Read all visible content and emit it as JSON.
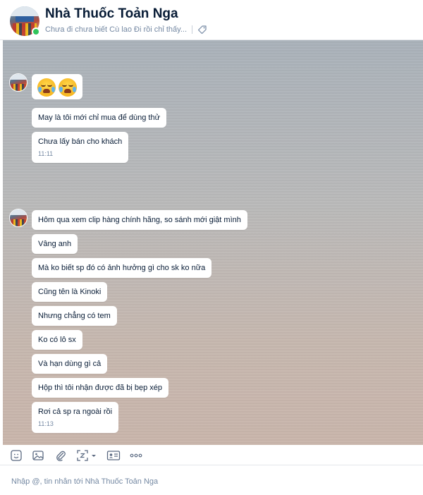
{
  "header": {
    "title": "Nhà Thuốc Toản Nga",
    "subtitle": "Chưa đi chưa biết Cù lao Đi rồi chỉ thấy...",
    "online_color": "#31c45b"
  },
  "chat": {
    "group1": {
      "emoji": [
        "crying-face",
        "crying-face"
      ],
      "messages": [
        {
          "text": "May là tôi mới chỉ mua để dùng thử"
        },
        {
          "text": "Chưa lấy bán cho khách",
          "time": "11:11"
        }
      ]
    },
    "group2": {
      "messages": [
        {
          "text": "Hôm qua xem clip hàng chính hãng, so sánh mới giật mình"
        },
        {
          "text": "Vâng anh"
        },
        {
          "text": "Mà ko biết sp đó có ảnh hưởng gì cho sk ko nữa"
        },
        {
          "text": "Cũng tên là Kinoki"
        },
        {
          "text": "Nhưng chẳng có tem"
        },
        {
          "text": "Ko có lô sx"
        },
        {
          "text": "Và hạn dùng gì cả"
        },
        {
          "text": "Hộp thì tôi nhận được đã bị bẹp xép"
        },
        {
          "text": "Rơi cả sp ra ngoài rồi",
          "time": "11:13"
        }
      ]
    }
  },
  "toolbar": {
    "icons": [
      "sticker-icon",
      "image-icon",
      "attach-icon",
      "screenshot-icon",
      "contact-card-icon",
      "more-icon"
    ]
  },
  "composer": {
    "placeholder": "Nhập @, tin nhắn tới Nhà Thuốc Toản Nga"
  }
}
